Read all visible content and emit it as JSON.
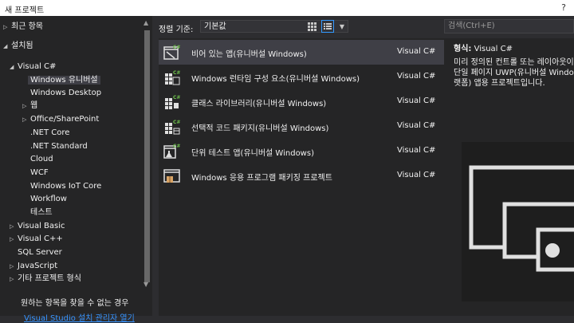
{
  "window": {
    "title": "새 프로젝트",
    "help": "?"
  },
  "tree": {
    "recent": "최근 항목",
    "installed": "설치됨",
    "visual_csharp": "Visual C#",
    "children": [
      "Windows 유니버설",
      "Windows Desktop",
      "웹",
      "Office/SharePoint",
      ".NET Core",
      ".NET Standard",
      "Cloud",
      "WCF",
      "Windows IoT Core",
      "Workflow",
      "테스트"
    ],
    "others": [
      "Visual Basic",
      "Visual C++",
      "SQL Server",
      "JavaScript",
      "기타 프로젝트 형식"
    ],
    "not_found": "원하는 항목을 찾을 수 없는 경우",
    "installer_link": "Visual Studio 설치 관리자 열기"
  },
  "sort": {
    "label": "정렬 기준:",
    "value": "기본값"
  },
  "templates": [
    {
      "name": "비어 있는 앱(유니버설 Windows)",
      "lang": "Visual C#",
      "icon": "blank-app-icon"
    },
    {
      "name": "Windows 런타임 구성 요소(유니버설 Windows)",
      "lang": "Visual C#",
      "icon": "runtime-component-icon"
    },
    {
      "name": "클래스 라이브러리(유니버설 Windows)",
      "lang": "Visual C#",
      "icon": "class-library-icon"
    },
    {
      "name": "선택적 코드 패키지(유니버설 Windows)",
      "lang": "Visual C#",
      "icon": "optional-code-package-icon"
    },
    {
      "name": "단위 테스트 앱(유니버설 Windows)",
      "lang": "Visual C#",
      "icon": "unit-test-app-icon"
    },
    {
      "name": "Windows 응용 프로그램 패키징 프로젝트",
      "lang": "Visual C#",
      "icon": "packaging-project-icon"
    }
  ],
  "search": {
    "placeholder": "검색(Ctrl+E)"
  },
  "detail": {
    "type_label": "형식:",
    "type_value": "Visual C#",
    "description": "미리 정의된 컨트롤 또는 레이아웃이\n단일 페이지 UWP(유니버설 Window\n랫폼) 앱용 프로젝트입니다."
  },
  "colors": {
    "accent": "#3399ff",
    "link": "#3794ff",
    "csharp_badge": "#6dbf4b"
  }
}
